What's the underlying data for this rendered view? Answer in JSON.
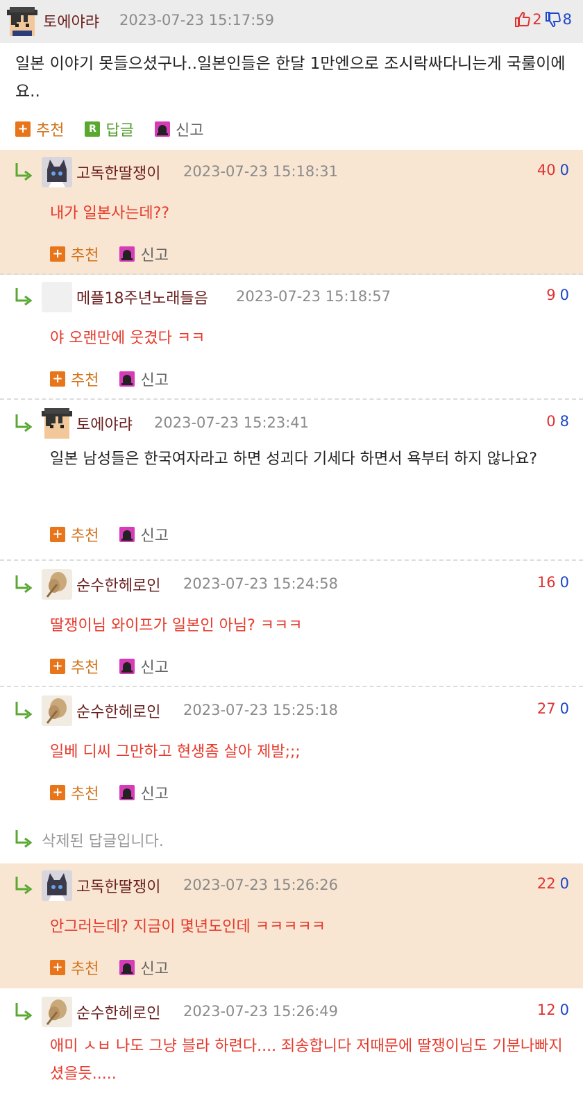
{
  "top": {
    "nick": "토에야랴",
    "time": "2023-07-23 15:17:59",
    "up": "2",
    "down": "8",
    "text": "일본 이야기 못들으셨구나..일본인들은 한달 1만엔으로 조시락싸다니는게 국룰이에요..",
    "recommend_label": "추천",
    "reply_label": "답글",
    "report_label": "신고"
  },
  "replies": [
    {
      "nick": "고독한딸쟁이",
      "time": "2023-07-23 15:18:31",
      "up": "40",
      "down": "0",
      "text": "내가 일본사는데??"
    },
    {
      "nick": "메플18주년노래들음",
      "time": "2023-07-23 15:18:57",
      "up": "9",
      "down": "0",
      "text": "야 오랜만에 웃겼다 ㅋㅋ"
    },
    {
      "nick": "토에야랴",
      "time": "2023-07-23 15:23:41",
      "up": "0",
      "down": "8",
      "text": "일본 남성들은 한국여자라고 하면 성괴다 기세다 하면서 욕부터 하지 않나요?"
    },
    {
      "nick": "순수한헤로인",
      "time": "2023-07-23 15:24:58",
      "up": "16",
      "down": "0",
      "text": "딸쟁이님 와이프가 일본인 아님? ㅋㅋㅋ"
    },
    {
      "nick": "순수한헤로인",
      "time": "2023-07-23 15:25:18",
      "up": "27",
      "down": "0",
      "text": "일베 디씨 그만하고 현생좀 살아 제발;;;"
    },
    {
      "nick": "고독한딸쟁이",
      "time": "2023-07-23 15:26:26",
      "up": "22",
      "down": "0",
      "text": "안그러는데? 지금이 몇년도인데 ㅋㅋㅋㅋㅋ"
    },
    {
      "nick": "순수한헤로인",
      "time": "2023-07-23 15:26:49",
      "up": "12",
      "down": "0",
      "text": "애미 ㅅㅂ 나도 그냥 블라 하련다.... 죄송합니다 저때문에 딸쟁이님도 기분나빠지셨을듯....."
    }
  ],
  "deleted_text": "삭제된 답글입니다.",
  "colors": {
    "up": "#e03131",
    "down": "#1c47c8",
    "highlight": "#f8e6d2",
    "reply_text": "#e6392b"
  }
}
